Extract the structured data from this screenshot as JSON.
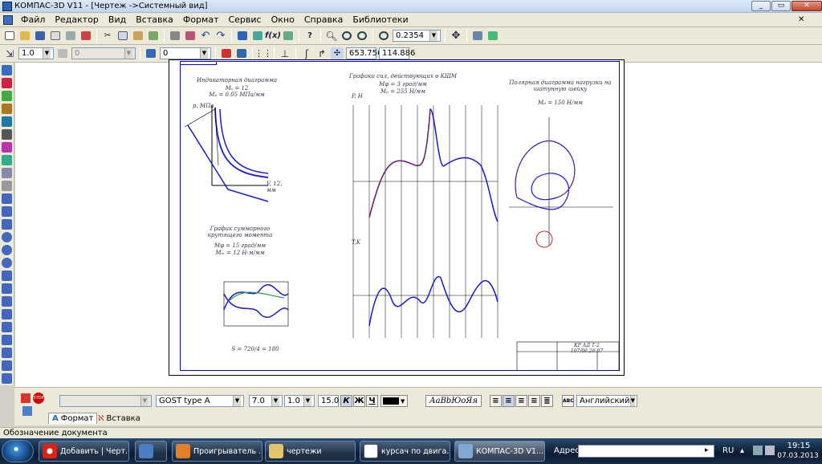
{
  "window": {
    "title": "КОМПАС-3D V11 - [Чертеж ->Системный вид]"
  },
  "menu": [
    "Файл",
    "Редактор",
    "Вид",
    "Вставка",
    "Формат",
    "Сервис",
    "Окно",
    "Справка",
    "Библиотеки"
  ],
  "toolbar_std": {
    "zoom": "0.2354"
  },
  "toolbar_cur": {
    "step": "1.0",
    "angle_disabled": "0",
    "layer": "0",
    "x": "653.756",
    "y": "114.886"
  },
  "drawing": {
    "indicator_title": "Индикаторная диаграмма",
    "indicator_m1": "Mₛ = 12",
    "indicator_m2": "Mₚ = 0.05 МПа/мм",
    "p_axis": "p, МПа",
    "v_axis": "V, 12, мм",
    "forces_title": "Графики сил, действующих в КШМ",
    "forces_m1": "Mφ = 3 град/мм",
    "forces_m2": "Mₚ = 255 Н/мм",
    "polar_title": "Полярная диаграмма нагрузки на шатунную шейку",
    "polar_m": "Mₚ = 150 Н/мм",
    "torque_title": "График суммарного крутящего момента",
    "torque_m1": "Mφ = 15 град/мм",
    "torque_m2": "Mₘ = 12 Н·м/мм",
    "pn_label": "P, Н",
    "tk_label": "T,K",
    "stamp_code": "КР АД Т-2 107/06.26.07",
    "torque_axis": "S = 720/4 = 180"
  },
  "props": {
    "font": "GOST type A",
    "height": "7.0",
    "narrow": "1.0",
    "step": "15.0",
    "bold": "К",
    "italic": "Ж",
    "under": "Ч",
    "sample": "АаBbЮоЯя",
    "lang": "Английский",
    "tab1": "Формат",
    "tab2": "Вставка"
  },
  "status": "Обозначение документа",
  "taskbar": {
    "items": [
      "Добавить | Черт...",
      "Проигрыватель ...",
      "чертежи",
      "курсач по двига...",
      "КОМПАС-3D V1..."
    ],
    "address_label": "Адрес",
    "lang": "RU",
    "time": "19:15",
    "date": "07.03.2013"
  },
  "colors": {
    "accent": "#2a63b7",
    "sheet_border": "#0000dd",
    "curve_blue": "#1a1acc",
    "curve_red": "#cc2222"
  }
}
